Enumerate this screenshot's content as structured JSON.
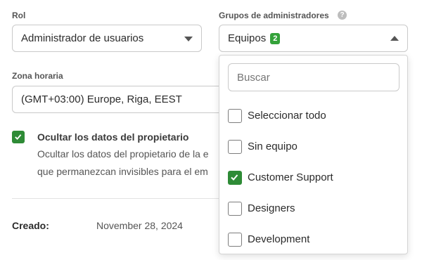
{
  "role": {
    "label": "Rol",
    "value": "Administrador de usuarios"
  },
  "admin_groups": {
    "label": "Grupos de administradores",
    "help_symbol": "?",
    "value": "Equipos",
    "badge_count": "2",
    "dropdown_open": true,
    "search_placeholder": "Buscar",
    "options": [
      {
        "label": "Seleccionar todo",
        "checked": false
      },
      {
        "label": "Sin equipo",
        "checked": false
      },
      {
        "label": "Customer Support",
        "checked": true
      },
      {
        "label": "Designers",
        "checked": false
      },
      {
        "label": "Development",
        "checked": false
      }
    ]
  },
  "timezone": {
    "label": "Zona horaria",
    "value": "(GMT+03:00) Europe, Riga, EEST"
  },
  "hide_owner": {
    "checked": true,
    "title": "Ocultar los datos del propietario",
    "desc_line1": "Ocultar los datos del propietario de la e",
    "desc_line2": "que permanezcan invisibles para el em"
  },
  "created": {
    "label": "Creado:",
    "value": "November 28, 2024"
  },
  "colors": {
    "accent_green": "#2e8b36",
    "badge_green": "#34a23a"
  }
}
